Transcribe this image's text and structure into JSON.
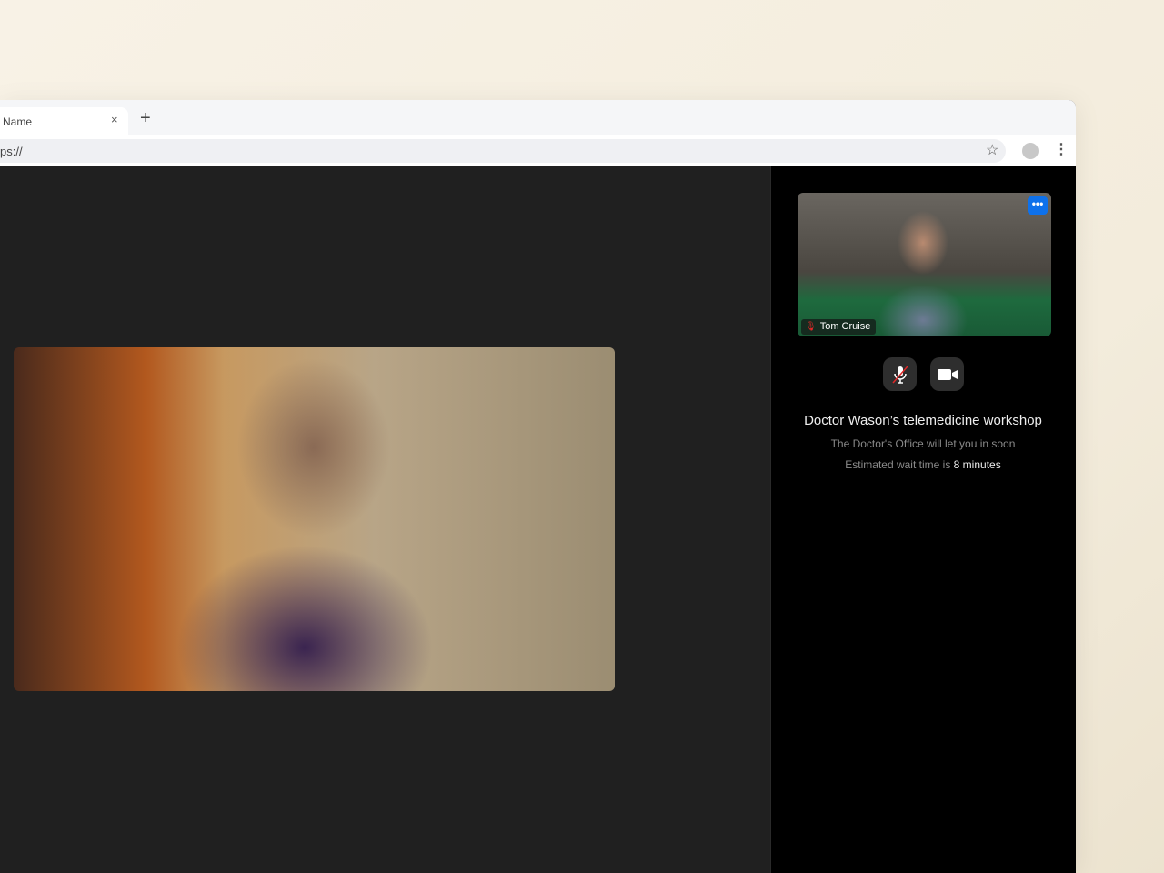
{
  "browser": {
    "tab_title": "Name",
    "close_icon": "×",
    "new_tab_icon": "+",
    "url": "ps://",
    "star_icon": "☆",
    "menu_icon": "⋮"
  },
  "main_video": {
    "description_icon": "doctor-video-feed"
  },
  "self_view": {
    "participant_name": "Tom Cruise",
    "more_icon": "•••",
    "mic_muted": true
  },
  "controls": {
    "mic": "muted",
    "camera": "on"
  },
  "waiting": {
    "title": "Doctor Wason’s telemedicine workshop",
    "message": "The Doctor's Office will let you in soon",
    "wait_prefix": "Estimated wait time is",
    "wait_value": "8 minutes"
  },
  "colors": {
    "accent": "#0e71eb",
    "muted": "#e02828"
  }
}
